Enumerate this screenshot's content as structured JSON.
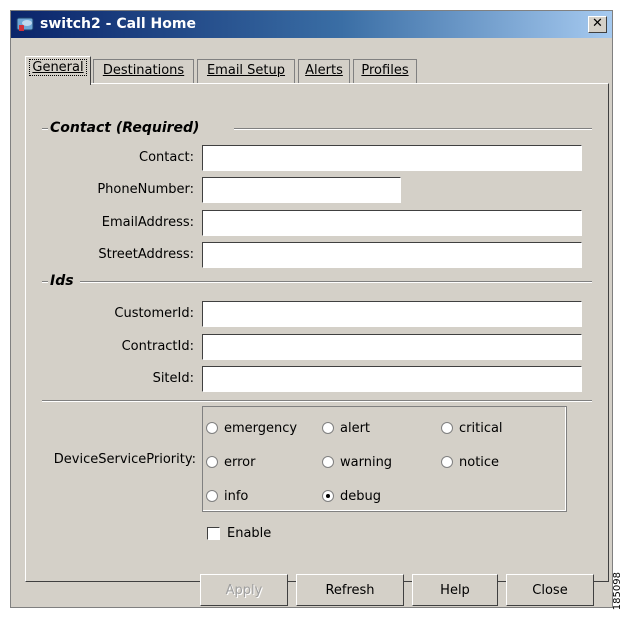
{
  "window": {
    "title": "switch2 - Call Home",
    "close_label": "✕"
  },
  "tabs": [
    {
      "label": "General",
      "active": true
    },
    {
      "label": "Destinations",
      "active": false
    },
    {
      "label": "Email Setup",
      "active": false
    },
    {
      "label": "Alerts",
      "active": false
    },
    {
      "label": "Profiles",
      "active": false
    }
  ],
  "contact_section": {
    "title": "Contact (Required)",
    "fields": [
      {
        "label": "Contact:",
        "value": ""
      },
      {
        "label": "PhoneNumber:",
        "value": ""
      },
      {
        "label": "EmailAddress:",
        "value": ""
      },
      {
        "label": "StreetAddress:",
        "value": ""
      }
    ]
  },
  "ids_section": {
    "title": "Ids",
    "fields": [
      {
        "label": "CustomerId:",
        "value": ""
      },
      {
        "label": "ContractId:",
        "value": ""
      },
      {
        "label": "SiteId:",
        "value": ""
      }
    ]
  },
  "priority": {
    "label": "DeviceServicePriority:",
    "options": [
      "emergency",
      "alert",
      "critical",
      "error",
      "warning",
      "notice",
      "info",
      "debug"
    ],
    "selected": "debug"
  },
  "enable": {
    "label": "Enable",
    "checked": false
  },
  "buttons": {
    "apply": "Apply",
    "refresh": "Refresh",
    "help": "Help",
    "close": "Close"
  },
  "figure_id": "185098"
}
